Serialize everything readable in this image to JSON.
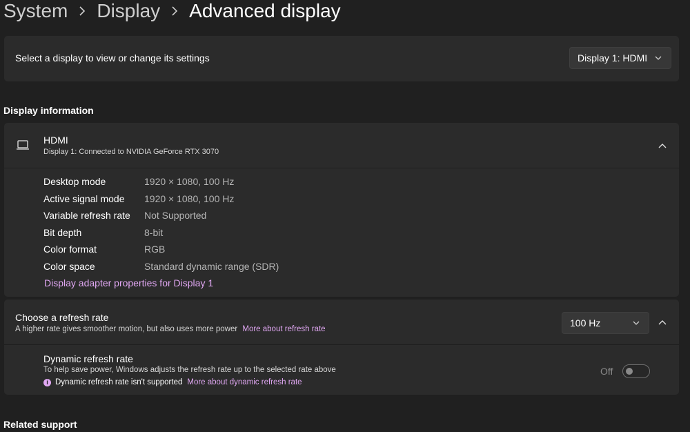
{
  "breadcrumb": {
    "items": [
      "System",
      "Display",
      "Advanced display"
    ]
  },
  "select_display": {
    "label": "Select a display to view or change its settings",
    "dropdown_value": "Display 1: HDMI"
  },
  "display_information": {
    "heading": "Display information",
    "title": "HDMI",
    "subtitle": "Display 1: Connected to NVIDIA GeForce RTX 3070",
    "rows": [
      {
        "label": "Desktop mode",
        "value": "1920 × 1080, 100 Hz"
      },
      {
        "label": "Active signal mode",
        "value": "1920 × 1080, 100 Hz"
      },
      {
        "label": "Variable refresh rate",
        "value": "Not Supported"
      },
      {
        "label": "Bit depth",
        "value": "8-bit"
      },
      {
        "label": "Color format",
        "value": "RGB"
      },
      {
        "label": "Color space",
        "value": "Standard dynamic range (SDR)"
      }
    ],
    "adapter_link": "Display adapter properties for Display 1"
  },
  "refresh_rate": {
    "title": "Choose a refresh rate",
    "description": "A higher rate gives smoother motion, but also uses more power",
    "link": "More about refresh rate",
    "dropdown_value": "100 Hz",
    "dynamic": {
      "title": "Dynamic refresh rate",
      "description": "To help save power, Windows adjusts the refresh rate up to the selected rate above",
      "warning": "Dynamic refresh rate isn't supported",
      "warning_link": "More about dynamic refresh rate",
      "toggle_label": "Off"
    }
  },
  "related_support": {
    "heading": "Related support"
  },
  "colors": {
    "background": "#202020",
    "card": "#2b2b2b",
    "accent_link": "#e0a7f2"
  },
  "icons": {
    "display": "laptop-icon",
    "chevron_right": "chevron-right-icon",
    "chevron_down": "chevron-down-icon",
    "chevron_up": "chevron-up-icon",
    "info": "info-icon"
  }
}
